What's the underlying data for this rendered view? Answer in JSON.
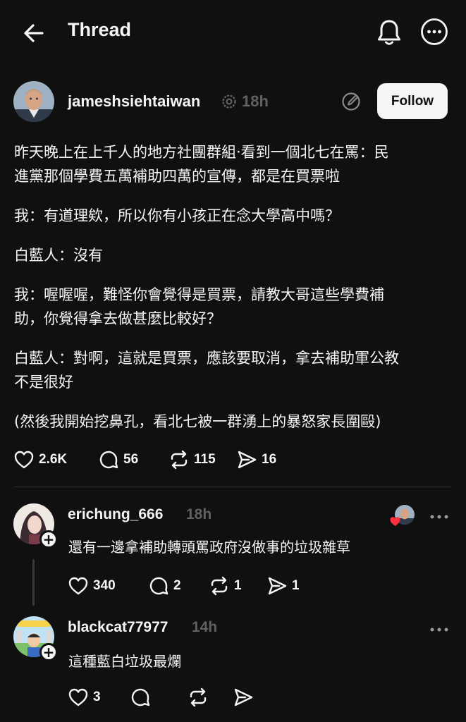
{
  "header": {
    "title": "Thread",
    "back_icon": "arrow-left-icon",
    "notify_icon": "bell-icon",
    "more_icon": "more-circle-icon"
  },
  "post": {
    "author": "jameshsiehtaiwan",
    "time": "18h",
    "follow_label": "Follow",
    "paragraphs": [
      "昨天晚上在上千人的地方社團群組‧看到一個北七在罵：民\n進黨那個學費五萬補助四萬的宣傳，都是在買票啦",
      "我：有道理欸，所以你有小孩正在念大學高中嗎？",
      "白藍人：沒有",
      "我：喔喔喔，難怪你會覺得是買票，請教大哥這些學費補\n助，你覺得拿去做甚麼比較好？",
      "白藍人：對啊，這就是買票，應該要取消，拿去補助軍公教\n不是很好",
      "(然後我開始挖鼻孔，看北七被一群湧上的暴怒家長圍毆)"
    ],
    "likes": "2.6K",
    "replies": "56",
    "reposts": "115",
    "shares": "16"
  },
  "replies": [
    {
      "author": "erichung_666",
      "time": "18h",
      "text": "還有一邊拿補助轉頭罵政府沒做事的垃圾雜草",
      "likes": "340",
      "replies": "2",
      "reposts": "1",
      "shares": "1"
    },
    {
      "author": "blackcat77977",
      "time": "14h",
      "text": "這種藍白垃圾最爛",
      "likes": "3",
      "replies": "",
      "reposts": "",
      "shares": ""
    }
  ],
  "colors": {
    "background": "#101010",
    "text": "#f3f5f7",
    "muted": "#616161",
    "like_red": "#ff3040"
  }
}
